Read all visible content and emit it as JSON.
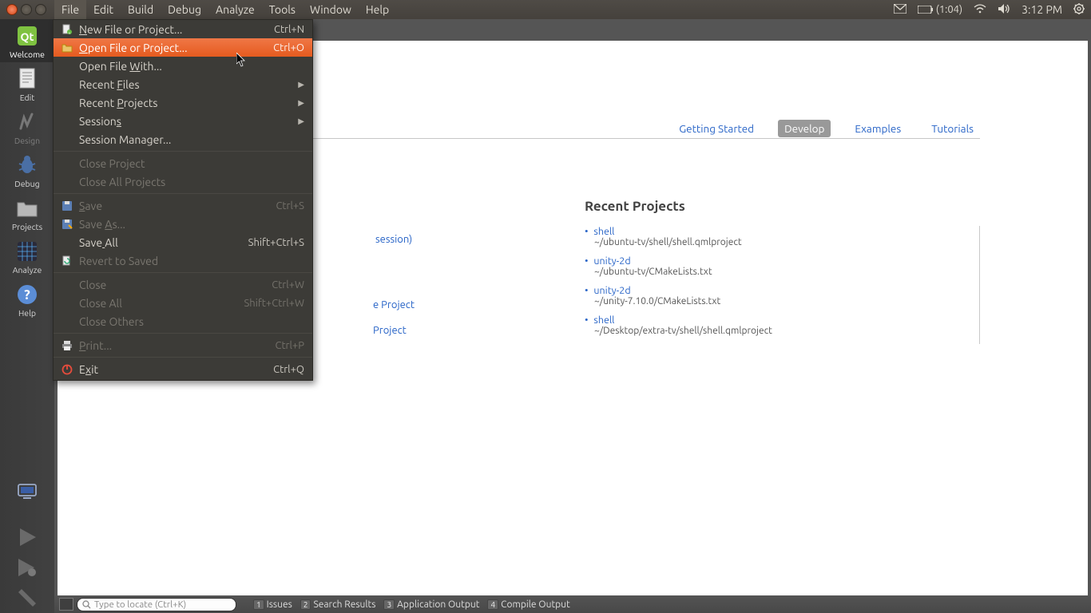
{
  "menubar": {
    "items": [
      "File",
      "Edit",
      "Build",
      "Debug",
      "Analyze",
      "Tools",
      "Window",
      "Help"
    ],
    "active_index": 0
  },
  "system_tray": {
    "battery_text": "(1:04)",
    "clock": "3:12 PM"
  },
  "file_menu": [
    {
      "type": "item",
      "icon": "new-file-icon",
      "label": "New File or Project...",
      "underline": 0,
      "shortcut": "Ctrl+N"
    },
    {
      "type": "item",
      "icon": "open-file-icon",
      "label": "Open File or Project...",
      "underline": 0,
      "shortcut": "Ctrl+O",
      "highlight": true
    },
    {
      "type": "item",
      "label": "Open File With...",
      "underline": 10
    },
    {
      "type": "item",
      "label": "Recent Files",
      "underline": 7,
      "submenu": true
    },
    {
      "type": "item",
      "label": "Recent Projects",
      "underline": 7,
      "submenu": true
    },
    {
      "type": "item",
      "label": "Sessions",
      "underline": 7,
      "submenu": true
    },
    {
      "type": "item",
      "label": "Session Manager..."
    },
    {
      "type": "sep"
    },
    {
      "type": "item",
      "label": "Close Project",
      "disabled": true
    },
    {
      "type": "item",
      "label": "Close All Projects",
      "disabled": true
    },
    {
      "type": "sep"
    },
    {
      "type": "item",
      "icon": "save-icon",
      "label": "Save",
      "underline": 0,
      "shortcut": "Ctrl+S",
      "disabled": true
    },
    {
      "type": "item",
      "icon": "save-as-icon",
      "label": "Save As...",
      "underline": 5,
      "disabled": true
    },
    {
      "type": "item",
      "label": "Save All",
      "underline": 4,
      "shortcut": "Shift+Ctrl+S"
    },
    {
      "type": "item",
      "icon": "revert-icon",
      "label": "Revert  to Saved",
      "disabled": true
    },
    {
      "type": "sep"
    },
    {
      "type": "item",
      "label": "Close",
      "shortcut": "Ctrl+W",
      "disabled": true
    },
    {
      "type": "item",
      "label": "Close All",
      "shortcut": "Shift+Ctrl+W",
      "disabled": true
    },
    {
      "type": "item",
      "label": "Close Others",
      "disabled": true
    },
    {
      "type": "sep"
    },
    {
      "type": "item",
      "icon": "print-icon",
      "label": "Print...",
      "underline": 0,
      "shortcut": "Ctrl+P",
      "disabled": true
    },
    {
      "type": "sep"
    },
    {
      "type": "item",
      "icon": "exit-icon",
      "label": "Exit",
      "underline": 1,
      "shortcut": "Ctrl+Q"
    }
  ],
  "modebar": [
    {
      "label": "Welcome",
      "icon": "qt-icon",
      "selected": true
    },
    {
      "label": "Edit",
      "icon": "edit-doc-icon"
    },
    {
      "label": "Design",
      "icon": "design-icon",
      "dim": true
    },
    {
      "label": "Debug",
      "icon": "debug-bug-icon"
    },
    {
      "label": "Projects",
      "icon": "projects-folder-icon"
    },
    {
      "label": "Analyze",
      "icon": "analyze-grid-icon"
    },
    {
      "label": "Help",
      "icon": "help-icon"
    }
  ],
  "welcome_tabs": [
    {
      "label": "Getting Started"
    },
    {
      "label": "Develop",
      "active": true
    },
    {
      "label": "Examples"
    },
    {
      "label": "Tutorials"
    }
  ],
  "peek_texts": {
    "session": "session)",
    "proj1": "e Project",
    "proj2": "Project"
  },
  "recent_projects_heading": "Recent Projects",
  "recent_projects": [
    {
      "name": "shell",
      "path": "~/ubuntu-tv/shell/shell.qmlproject"
    },
    {
      "name": "unity-2d",
      "path": "~/ubuntu-tv/CMakeLists.txt"
    },
    {
      "name": "unity-2d",
      "path": "~/unity-7.10.0/CMakeLists.txt"
    },
    {
      "name": "shell",
      "path": "~/Desktop/extra-tv/shell/shell.qmlproject"
    }
  ],
  "statusbar": {
    "locator_placeholder": "Type to locate (Ctrl+K)",
    "panes": [
      {
        "num": "1",
        "label": "Issues"
      },
      {
        "num": "2",
        "label": "Search Results"
      },
      {
        "num": "3",
        "label": "Application Output"
      },
      {
        "num": "4",
        "label": "Compile Output"
      }
    ]
  }
}
